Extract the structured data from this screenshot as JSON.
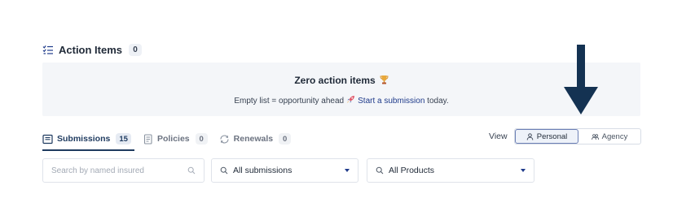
{
  "action_items": {
    "title": "Action Items",
    "count": "0",
    "empty_title": "Zero action items",
    "empty_desc_prefix": "Empty list = opportunity ahead",
    "empty_link": "Start a submission",
    "empty_desc_suffix": " today."
  },
  "tabs": [
    {
      "label": "Submissions",
      "count": "15",
      "active": true,
      "icon": "list-icon"
    },
    {
      "label": "Policies",
      "count": "0",
      "active": false,
      "icon": "document-icon"
    },
    {
      "label": "Renewals",
      "count": "0",
      "active": false,
      "icon": "refresh-icon"
    }
  ],
  "view": {
    "label": "View",
    "options": [
      {
        "label": "Personal",
        "active": true,
        "icon": "person-icon"
      },
      {
        "label": "Agency",
        "active": false,
        "icon": "people-icon"
      }
    ]
  },
  "filters": {
    "search_placeholder": "Search by named insured",
    "submissions_value": "All submissions",
    "products_value": "All Products"
  },
  "colors": {
    "accent": "#1e3a5f",
    "link": "#1e3a8a",
    "panel_bg": "#f4f6f9",
    "annotation_arrow": "#143252"
  }
}
